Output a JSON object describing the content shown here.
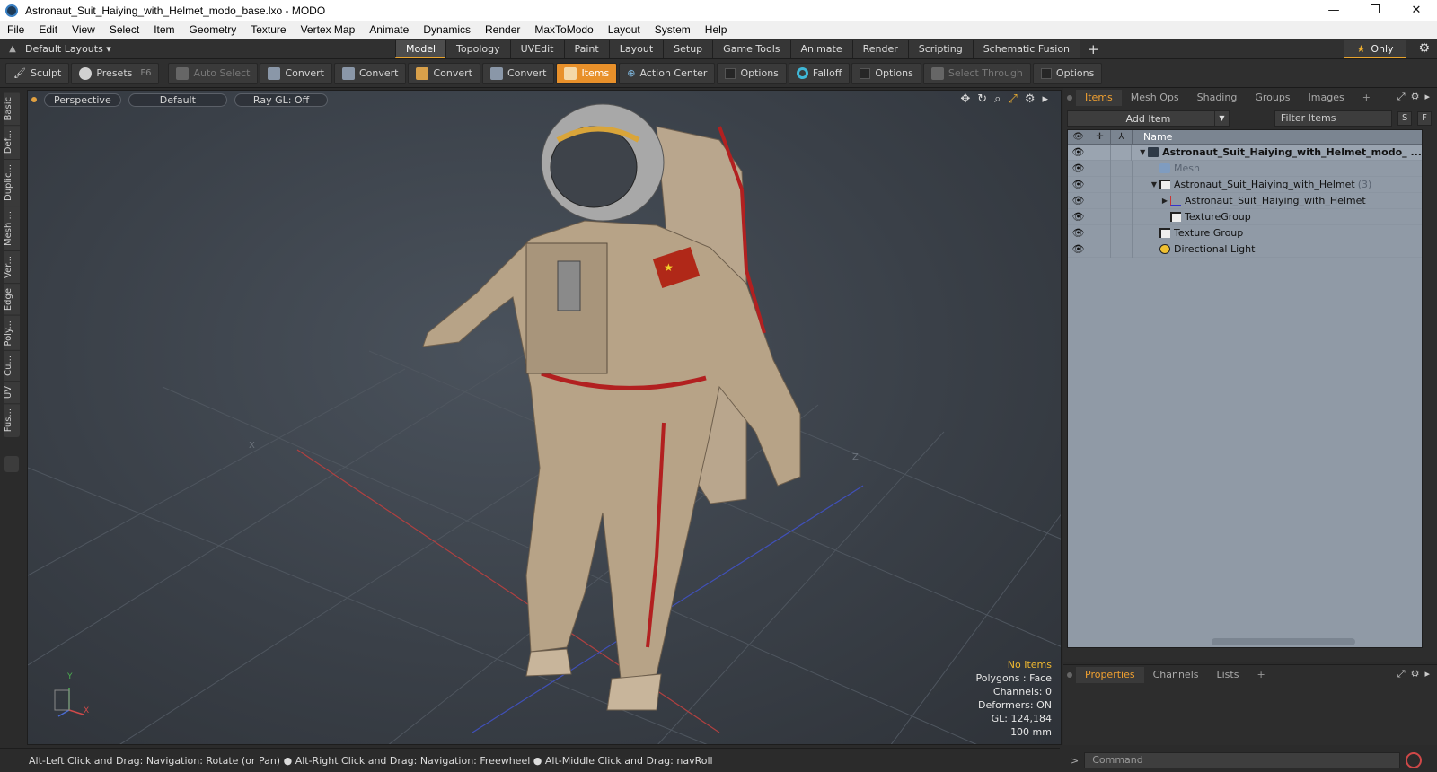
{
  "window": {
    "title": "Astronaut_Suit_Haiying_with_Helmet_modo_base.lxo - MODO",
    "controls": [
      "—",
      "❐",
      "✕"
    ]
  },
  "menubar": [
    "File",
    "Edit",
    "View",
    "Select",
    "Item",
    "Geometry",
    "Texture",
    "Vertex Map",
    "Animate",
    "Dynamics",
    "Render",
    "MaxToModo",
    "Layout",
    "System",
    "Help"
  ],
  "layoutbar": {
    "layouts_label": "Default Layouts ▾",
    "tabs": [
      "Model",
      "Topology",
      "UVEdit",
      "Paint",
      "Layout",
      "Setup",
      "Game Tools",
      "Animate",
      "Render",
      "Scripting",
      "Schematic Fusion"
    ],
    "active_tab": "Model",
    "plus": "+",
    "only_label": "Only",
    "only_star": "★"
  },
  "toolbar": {
    "sculpt": "Sculpt",
    "presets": "Presets",
    "presets_key": "F6",
    "auto_select": "Auto Select",
    "convert_1": "Convert",
    "convert_2": "Convert",
    "convert_3": "Convert",
    "convert_4": "Convert",
    "items": "Items",
    "action_center": "Action Center",
    "options_1": "Options",
    "falloff": "Falloff",
    "options_2": "Options",
    "select_through": "Select Through",
    "options_3": "Options"
  },
  "left_tabs": [
    "Basic",
    "Def...",
    "Duplic...",
    "Mesh ...",
    "Ver...",
    "Edge",
    "Poly...",
    "Cu...",
    "UV",
    "Fus..."
  ],
  "viewport": {
    "view": "Perspective",
    "shading": "Default",
    "raygl": "Ray GL: Off",
    "info": {
      "selection": "No Items",
      "polygons": "Polygons : Face",
      "channels": "Channels: 0",
      "deformers": "Deformers: ON",
      "gl": "GL: 124,184",
      "scale": "100 mm"
    },
    "axis_labels": {
      "x": "X",
      "y": "Y",
      "z": "Z"
    }
  },
  "statusbar": "Alt-Left Click and Drag: Navigation: Rotate (or Pan) ● Alt-Right Click and Drag: Navigation: Freewheel ● Alt-Middle Click and Drag: navRoll",
  "items_panel": {
    "tabs": [
      "Items",
      "Mesh Ops",
      "Shading",
      "Groups",
      "Images",
      "+"
    ],
    "active_tab": "Items",
    "add_item": "Add Item",
    "filter": "Filter Items",
    "s_btn": "S",
    "f_btn": "F",
    "name_col": "Name",
    "rows": [
      {
        "label": "Astronaut_Suit_Haiying_with_Helmet_modo_ ...",
        "arrow": "▼",
        "icon": "scene",
        "bold": true,
        "indent": 0
      },
      {
        "label": "Mesh",
        "arrow": "",
        "icon": "mesh",
        "dim": true,
        "indent": 1
      },
      {
        "label": "Astronaut_Suit_Haiying_with_Helmet",
        "count": "(3)",
        "arrow": "▼",
        "icon": "group",
        "indent": 1
      },
      {
        "label": "Astronaut_Suit_Haiying_with_Helmet",
        "arrow": "▶",
        "icon": "loc",
        "indent": 2
      },
      {
        "label": "TextureGroup",
        "arrow": "",
        "icon": "group",
        "indent": 2
      },
      {
        "label": "Texture Group",
        "arrow": "",
        "icon": "group",
        "indent": 1
      },
      {
        "label": "Directional Light",
        "arrow": "",
        "icon": "light",
        "indent": 1
      }
    ]
  },
  "props_panel": {
    "tabs": [
      "Properties",
      "Channels",
      "Lists",
      "+"
    ],
    "active_tab": "Properties"
  },
  "command": {
    "prompt": ">",
    "placeholder": "Command"
  }
}
